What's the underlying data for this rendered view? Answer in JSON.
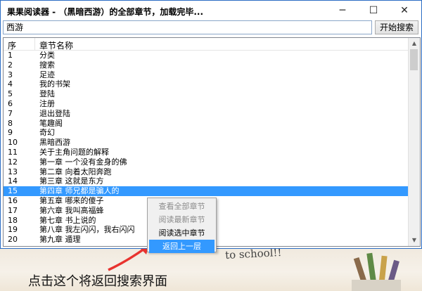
{
  "window": {
    "title": "果果阅读器 - （黑暗西游）的全部章节，加载完毕...",
    "minimize_glyph": "─",
    "maximize_glyph": "☐",
    "close_glyph": "✕"
  },
  "search": {
    "value": "西游",
    "button_label": "开始搜索"
  },
  "table": {
    "columns": [
      "序",
      "章节名称"
    ],
    "rows": [
      {
        "n": "1",
        "t": "分类"
      },
      {
        "n": "2",
        "t": "搜索"
      },
      {
        "n": "3",
        "t": "足迹"
      },
      {
        "n": "4",
        "t": "我的书架"
      },
      {
        "n": "5",
        "t": "登陆"
      },
      {
        "n": "6",
        "t": "注册"
      },
      {
        "n": "7",
        "t": "退出登陆"
      },
      {
        "n": "8",
        "t": "笔趣阁"
      },
      {
        "n": "9",
        "t": "奇幻"
      },
      {
        "n": "10",
        "t": "黑暗西游"
      },
      {
        "n": "11",
        "t": "关于主角问题的解释"
      },
      {
        "n": "12",
        "t": "第一章 一个没有金身的佛"
      },
      {
        "n": "13",
        "t": "第二章 向着太阳奔跑"
      },
      {
        "n": "14",
        "t": "第三章 这就是东方"
      },
      {
        "n": "15",
        "t": "第四章 师兄都是骗人的"
      },
      {
        "n": "16",
        "t": "第五章 哪来的傻子"
      },
      {
        "n": "17",
        "t": "第六章 我叫高福蜂"
      },
      {
        "n": "18",
        "t": "第七章 书上说的"
      },
      {
        "n": "19",
        "t": "第八章 我左闪闪，我右闪闪"
      },
      {
        "n": "20",
        "t": "第九章 遁理"
      }
    ],
    "selected_row": "15"
  },
  "context_menu": {
    "items": [
      {
        "label": "查看全部章节",
        "state": "disabled"
      },
      {
        "label": "阅读最新章节",
        "state": "disabled"
      },
      {
        "label": "阅读选中章节",
        "state": "enabled"
      },
      {
        "label": "返回上一层",
        "state": "highlighted"
      }
    ]
  },
  "background": {
    "chalk_text": "to school!!",
    "caption": "点击这个将返回搜索界面"
  },
  "colors": {
    "selection": "#3399ff",
    "arrow": "#e8332f",
    "window_border": "#2b6cc4"
  }
}
